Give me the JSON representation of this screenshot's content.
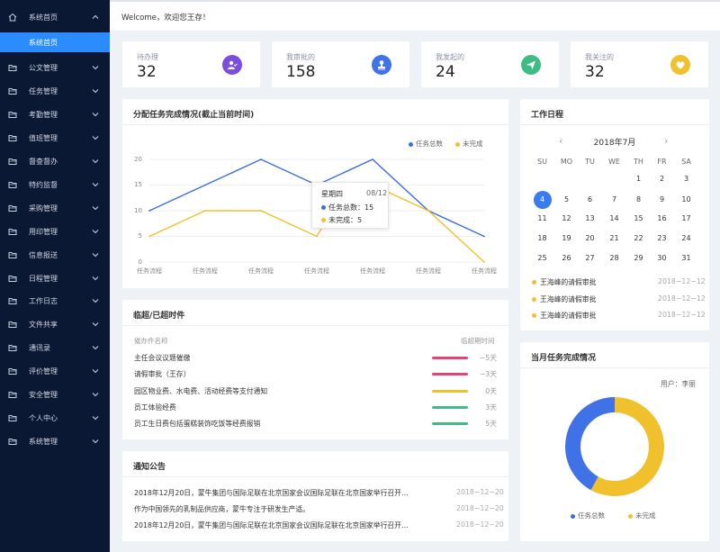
{
  "colors": {
    "sidebar_bg": "#0b1833",
    "accent": "#2a8cff",
    "blue": "#3d6fd9",
    "yellow": "#f0c12c"
  },
  "sidebar": {
    "items": [
      {
        "label": "系统首页",
        "icon": "home-icon",
        "expanded": true
      },
      {
        "label": "公文管理",
        "icon": "folder-icon"
      },
      {
        "label": "任务管理",
        "icon": "folder-icon"
      },
      {
        "label": "考勤管理",
        "icon": "folder-icon"
      },
      {
        "label": "值班管理",
        "icon": "folder-icon"
      },
      {
        "label": "督查督办",
        "icon": "folder-icon"
      },
      {
        "label": "特约监督",
        "icon": "folder-icon"
      },
      {
        "label": "采购管理",
        "icon": "folder-icon"
      },
      {
        "label": "用印管理",
        "icon": "folder-icon"
      },
      {
        "label": "信息报送",
        "icon": "folder-icon"
      },
      {
        "label": "日程管理",
        "icon": "folder-icon"
      },
      {
        "label": "工作日志",
        "icon": "folder-icon"
      },
      {
        "label": "文件共享",
        "icon": "folder-icon"
      },
      {
        "label": "通讯录",
        "icon": "folder-icon"
      },
      {
        "label": "评价管理",
        "icon": "folder-icon"
      },
      {
        "label": "安全管理",
        "icon": "folder-icon"
      },
      {
        "label": "个人中心",
        "icon": "folder-icon"
      },
      {
        "label": "系统管理",
        "icon": "folder-icon"
      }
    ],
    "sub_item": "系统首页"
  },
  "header": {
    "welcome": "Welcome，欢迎您王存！"
  },
  "stats": [
    {
      "label": "待办理",
      "value": "32",
      "color": "#7b4ee0",
      "icon": "user-check-icon"
    },
    {
      "label": "我审批的",
      "value": "158",
      "color": "#3f72e6",
      "icon": "stamp-icon"
    },
    {
      "label": "我发起的",
      "value": "24",
      "color": "#3dbd84",
      "icon": "paper-plane-icon"
    },
    {
      "label": "我关注的",
      "value": "32",
      "color": "#f0c12c",
      "icon": "heart-icon"
    }
  ],
  "task_chart": {
    "title": "分配任务完成情况(截止当前时间)",
    "tooltip": {
      "day": "星期四",
      "date": "08/12",
      "total": "任务总数：15",
      "unfinished": "未完成：5"
    }
  },
  "chart_data": {
    "type": "line",
    "title": "分配任务完成情况(截止当前时间)",
    "categories": [
      "任务流程",
      "任务流程",
      "任务流程",
      "任务流程",
      "任务流程",
      "任务流程",
      "任务流程"
    ],
    "y_ticks": [
      "0",
      "5",
      "10",
      "15",
      "20"
    ],
    "ylim": [
      0,
      20
    ],
    "legend_position": "top-right",
    "grid": true,
    "series": [
      {
        "name": "任务总数",
        "color": "#3d6fd9",
        "values": [
          10,
          15,
          20,
          15,
          20,
          10,
          5
        ]
      },
      {
        "name": "未完成",
        "color": "#f0c12c",
        "values": [
          5,
          10,
          10,
          5,
          15,
          10,
          0
        ]
      }
    ],
    "extra_points": {
      "series_0": [
        [
          1.5,
          20
        ],
        [
          3.5,
          20
        ]
      ],
      "series_1": [
        [
          2.5,
          10
        ],
        [
          3.5,
          15
        ]
      ]
    }
  },
  "overdue": {
    "title": "临超/已超时件",
    "col_name": "催办件名称",
    "col_time": "临超期时间",
    "rows": [
      {
        "name": "主任会议议题催缴",
        "days": "−5天",
        "color": "#e0457b"
      },
      {
        "name": "请假审批（王存）",
        "days": "−3天",
        "color": "#e0457b"
      },
      {
        "name": "园区物业费、水电费、活动经费等支付通知",
        "days": "0天",
        "color": "#f0c12c"
      },
      {
        "name": "员工体验经费",
        "days": "3天",
        "color": "#3dbd84"
      },
      {
        "name": "员工生日费包括蛋糕装饰吃饭等经费报销",
        "days": "5天",
        "color": "#3dbd84"
      }
    ]
  },
  "notices": {
    "title": "通知公告",
    "rows": [
      {
        "text": "2018年12月20日，蒙牛集团与国际足联在北京国家会议国际足联在北京国家举行召开…",
        "date": "2018−12−20"
      },
      {
        "text": "作为中国领先的乳制品供应商，蒙牛专注于研发生产适。",
        "date": "2018−12−20"
      },
      {
        "text": "2018年12月20日，蒙牛集团与国际足联在北京国家会议国际足联在北京国家举行召开…",
        "date": "2018−12−20"
      }
    ]
  },
  "calendar": {
    "title": "工作日程",
    "month": "2018年7月",
    "weekdays": [
      "SU",
      "MO",
      "TU",
      "WE",
      "TH",
      "FR",
      "SA"
    ],
    "weeks": [
      [
        "",
        "",
        "",
        "",
        "1",
        "2",
        "3"
      ],
      [
        "4",
        "5",
        "6",
        "7",
        "8",
        "9",
        "10"
      ],
      [
        "11",
        "12",
        "13",
        "14",
        "15",
        "16",
        "17"
      ],
      [
        "18",
        "19",
        "20",
        "21",
        "22",
        "23",
        "24"
      ],
      [
        "25",
        "26",
        "27",
        "28",
        "29",
        "30",
        "31"
      ]
    ],
    "today": "4",
    "schedule": [
      {
        "name": "王海峰的请假审批",
        "date": "2018−12−12"
      },
      {
        "name": "王海峰的请假审批",
        "date": "2018−12−12"
      },
      {
        "name": "王海峰的请假审批",
        "date": "2018−12−12"
      }
    ]
  },
  "monthly": {
    "title": "当月任务完成情况",
    "user": "用户：李丽",
    "legend_total": "任务总数",
    "legend_unfinished": "未完成",
    "donut": {
      "total_fraction": 0.42,
      "unfinished_fraction": 0.58
    }
  }
}
